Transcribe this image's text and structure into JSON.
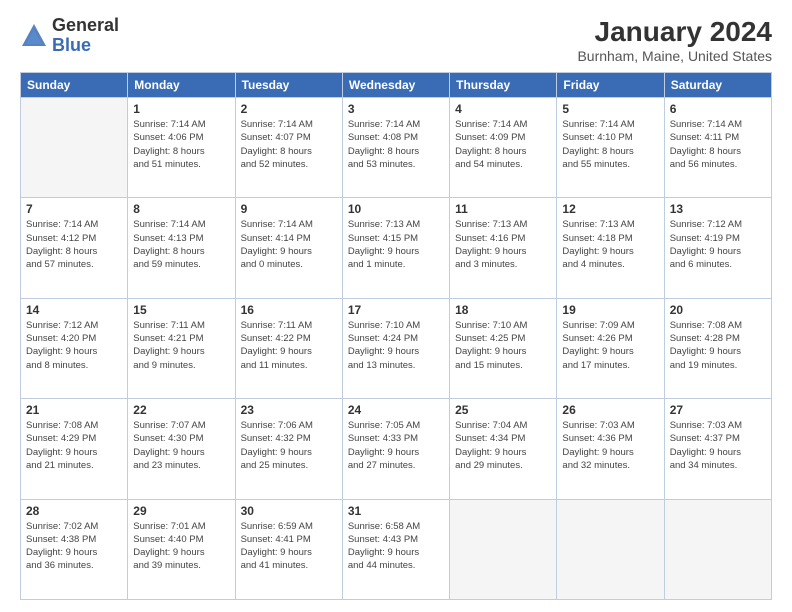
{
  "logo": {
    "general": "General",
    "blue": "Blue"
  },
  "title": {
    "month": "January 2024",
    "location": "Burnham, Maine, United States"
  },
  "headers": [
    "Sunday",
    "Monday",
    "Tuesday",
    "Wednesday",
    "Thursday",
    "Friday",
    "Saturday"
  ],
  "weeks": [
    [
      {
        "day": "",
        "info": ""
      },
      {
        "day": "1",
        "info": "Sunrise: 7:14 AM\nSunset: 4:06 PM\nDaylight: 8 hours\nand 51 minutes."
      },
      {
        "day": "2",
        "info": "Sunrise: 7:14 AM\nSunset: 4:07 PM\nDaylight: 8 hours\nand 52 minutes."
      },
      {
        "day": "3",
        "info": "Sunrise: 7:14 AM\nSunset: 4:08 PM\nDaylight: 8 hours\nand 53 minutes."
      },
      {
        "day": "4",
        "info": "Sunrise: 7:14 AM\nSunset: 4:09 PM\nDaylight: 8 hours\nand 54 minutes."
      },
      {
        "day": "5",
        "info": "Sunrise: 7:14 AM\nSunset: 4:10 PM\nDaylight: 8 hours\nand 55 minutes."
      },
      {
        "day": "6",
        "info": "Sunrise: 7:14 AM\nSunset: 4:11 PM\nDaylight: 8 hours\nand 56 minutes."
      }
    ],
    [
      {
        "day": "7",
        "info": "Sunrise: 7:14 AM\nSunset: 4:12 PM\nDaylight: 8 hours\nand 57 minutes."
      },
      {
        "day": "8",
        "info": "Sunrise: 7:14 AM\nSunset: 4:13 PM\nDaylight: 8 hours\nand 59 minutes."
      },
      {
        "day": "9",
        "info": "Sunrise: 7:14 AM\nSunset: 4:14 PM\nDaylight: 9 hours\nand 0 minutes."
      },
      {
        "day": "10",
        "info": "Sunrise: 7:13 AM\nSunset: 4:15 PM\nDaylight: 9 hours\nand 1 minute."
      },
      {
        "day": "11",
        "info": "Sunrise: 7:13 AM\nSunset: 4:16 PM\nDaylight: 9 hours\nand 3 minutes."
      },
      {
        "day": "12",
        "info": "Sunrise: 7:13 AM\nSunset: 4:18 PM\nDaylight: 9 hours\nand 4 minutes."
      },
      {
        "day": "13",
        "info": "Sunrise: 7:12 AM\nSunset: 4:19 PM\nDaylight: 9 hours\nand 6 minutes."
      }
    ],
    [
      {
        "day": "14",
        "info": "Sunrise: 7:12 AM\nSunset: 4:20 PM\nDaylight: 9 hours\nand 8 minutes."
      },
      {
        "day": "15",
        "info": "Sunrise: 7:11 AM\nSunset: 4:21 PM\nDaylight: 9 hours\nand 9 minutes."
      },
      {
        "day": "16",
        "info": "Sunrise: 7:11 AM\nSunset: 4:22 PM\nDaylight: 9 hours\nand 11 minutes."
      },
      {
        "day": "17",
        "info": "Sunrise: 7:10 AM\nSunset: 4:24 PM\nDaylight: 9 hours\nand 13 minutes."
      },
      {
        "day": "18",
        "info": "Sunrise: 7:10 AM\nSunset: 4:25 PM\nDaylight: 9 hours\nand 15 minutes."
      },
      {
        "day": "19",
        "info": "Sunrise: 7:09 AM\nSunset: 4:26 PM\nDaylight: 9 hours\nand 17 minutes."
      },
      {
        "day": "20",
        "info": "Sunrise: 7:08 AM\nSunset: 4:28 PM\nDaylight: 9 hours\nand 19 minutes."
      }
    ],
    [
      {
        "day": "21",
        "info": "Sunrise: 7:08 AM\nSunset: 4:29 PM\nDaylight: 9 hours\nand 21 minutes."
      },
      {
        "day": "22",
        "info": "Sunrise: 7:07 AM\nSunset: 4:30 PM\nDaylight: 9 hours\nand 23 minutes."
      },
      {
        "day": "23",
        "info": "Sunrise: 7:06 AM\nSunset: 4:32 PM\nDaylight: 9 hours\nand 25 minutes."
      },
      {
        "day": "24",
        "info": "Sunrise: 7:05 AM\nSunset: 4:33 PM\nDaylight: 9 hours\nand 27 minutes."
      },
      {
        "day": "25",
        "info": "Sunrise: 7:04 AM\nSunset: 4:34 PM\nDaylight: 9 hours\nand 29 minutes."
      },
      {
        "day": "26",
        "info": "Sunrise: 7:03 AM\nSunset: 4:36 PM\nDaylight: 9 hours\nand 32 minutes."
      },
      {
        "day": "27",
        "info": "Sunrise: 7:03 AM\nSunset: 4:37 PM\nDaylight: 9 hours\nand 34 minutes."
      }
    ],
    [
      {
        "day": "28",
        "info": "Sunrise: 7:02 AM\nSunset: 4:38 PM\nDaylight: 9 hours\nand 36 minutes."
      },
      {
        "day": "29",
        "info": "Sunrise: 7:01 AM\nSunset: 4:40 PM\nDaylight: 9 hours\nand 39 minutes."
      },
      {
        "day": "30",
        "info": "Sunrise: 6:59 AM\nSunset: 4:41 PM\nDaylight: 9 hours\nand 41 minutes."
      },
      {
        "day": "31",
        "info": "Sunrise: 6:58 AM\nSunset: 4:43 PM\nDaylight: 9 hours\nand 44 minutes."
      },
      {
        "day": "",
        "info": ""
      },
      {
        "day": "",
        "info": ""
      },
      {
        "day": "",
        "info": ""
      }
    ]
  ]
}
